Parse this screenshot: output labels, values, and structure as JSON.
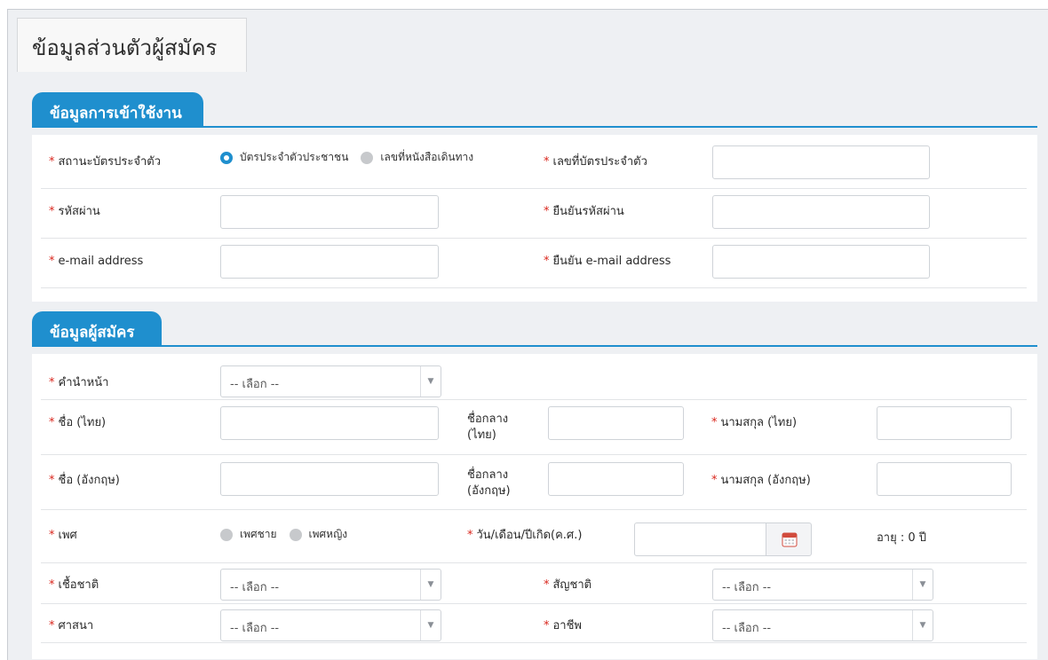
{
  "page": {
    "title": "ข้อมูลส่วนตัวผู้สมัคร"
  },
  "login_section": {
    "title": "ข้อมูลการเข้าใช้งาน",
    "id_type_label": "สถานะบัตรประจำตัว",
    "id_type_options": [
      {
        "label": "บัตรประจำตัวประชาชน",
        "selected": true
      },
      {
        "label": "เลขที่หนังสือเดินทาง",
        "selected": false
      }
    ],
    "id_number_label": "เลขที่บัตรประจำตัว",
    "password_label": "รหัสผ่าน",
    "confirm_password_label": "ยืนยันรหัสผ่าน",
    "email_label": "e-mail address",
    "confirm_email_label": "ยืนยัน e-mail address"
  },
  "applicant_section": {
    "title": "ข้อมูลผู้สมัคร",
    "prefix_label": "คำนำหน้า",
    "select_placeholder": "-- เลือก --",
    "first_name_th_label": "ชื่อ (ไทย)",
    "middle_name_th_label": "ชื่อกลาง (ไทย)",
    "last_name_th_label": "นามสกุล (ไทย)",
    "first_name_en_label": "ชื่อ (อังกฤษ)",
    "middle_name_en_label": "ชื่อกลาง (อังกฤษ)",
    "last_name_en_label": "นามสกุล (อังกฤษ)",
    "gender_label": "เพศ",
    "gender_options": [
      {
        "label": "เพศชาย",
        "selected": false
      },
      {
        "label": "เพศหญิง",
        "selected": false
      }
    ],
    "dob_label": "วัน/เดือน/ปีเกิด(ค.ศ.)",
    "age_text": "อายุ : 0 ปี",
    "ethnicity_label": "เชื้อชาติ",
    "nationality_label": "สัญชาติ",
    "religion_label": "ศาสนา",
    "occupation_label": "อาชีพ"
  },
  "required_mark": "*",
  "colors": {
    "accent": "#1f8fce",
    "required": "#d9261c"
  },
  "icons": {
    "calendar": "calendar-icon",
    "dropdown": "chevron-down-icon"
  }
}
